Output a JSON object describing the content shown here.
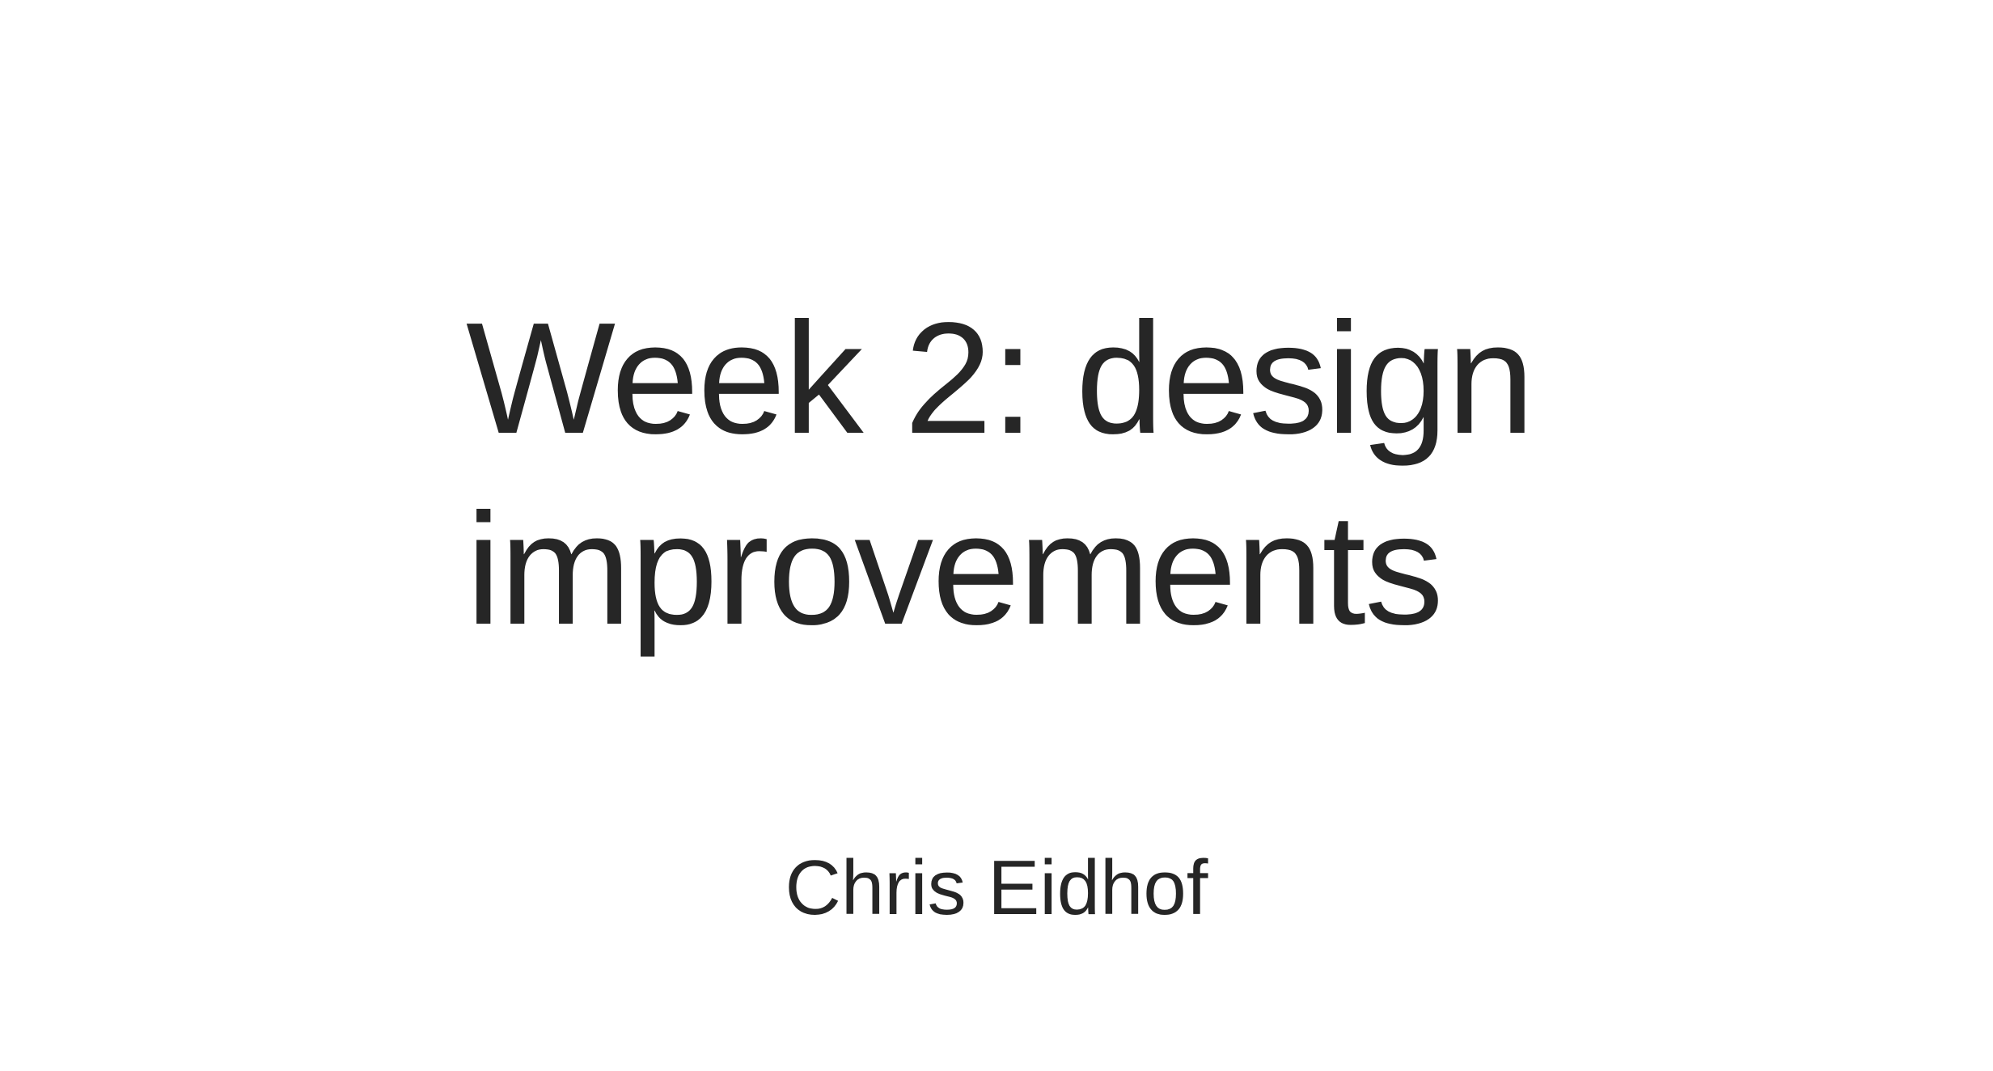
{
  "slide": {
    "title": "Week 2: design improvements",
    "author": "Chris Eidhof",
    "text_color": "#262626",
    "background_color": "#ffffff"
  }
}
